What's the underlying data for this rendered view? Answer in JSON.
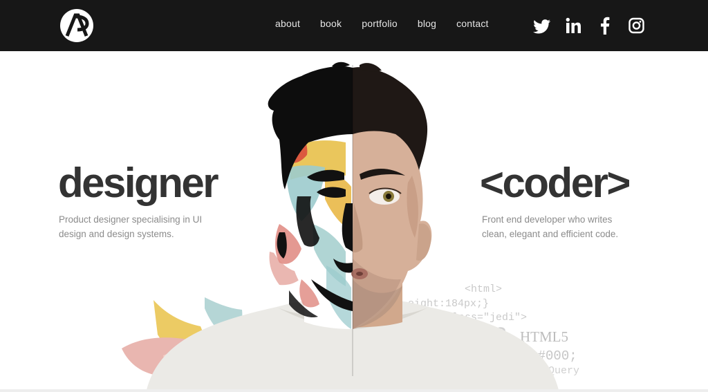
{
  "nav": {
    "items": [
      {
        "label": "about"
      },
      {
        "label": "book"
      },
      {
        "label": "portfolio"
      },
      {
        "label": "blog"
      },
      {
        "label": "contact"
      }
    ],
    "social": [
      "twitter-icon",
      "linkedin-icon",
      "facebook-icon",
      "instagram-icon"
    ]
  },
  "hero": {
    "left": {
      "title": "designer",
      "desc_line1": "Product designer specialising in UI",
      "desc_line2": "design and design systems."
    },
    "right": {
      "title": "<coder>",
      "desc_line1": "Front end developer who writes",
      "desc_line2": "clean, elegant and efficient code."
    },
    "code_snippets": {
      "html": "<html>",
      "height": "eight:184px;}",
      "class": "class=\"jedi\">",
      "css3": "SS3",
      "html5": "HTML5",
      "color": "lor:#000;",
      "jquery": "jQuery"
    }
  },
  "colors": {
    "nav_bg": "#171717",
    "title": "#333333",
    "desc": "#8b8b8b",
    "code": "#c9c9c9"
  }
}
